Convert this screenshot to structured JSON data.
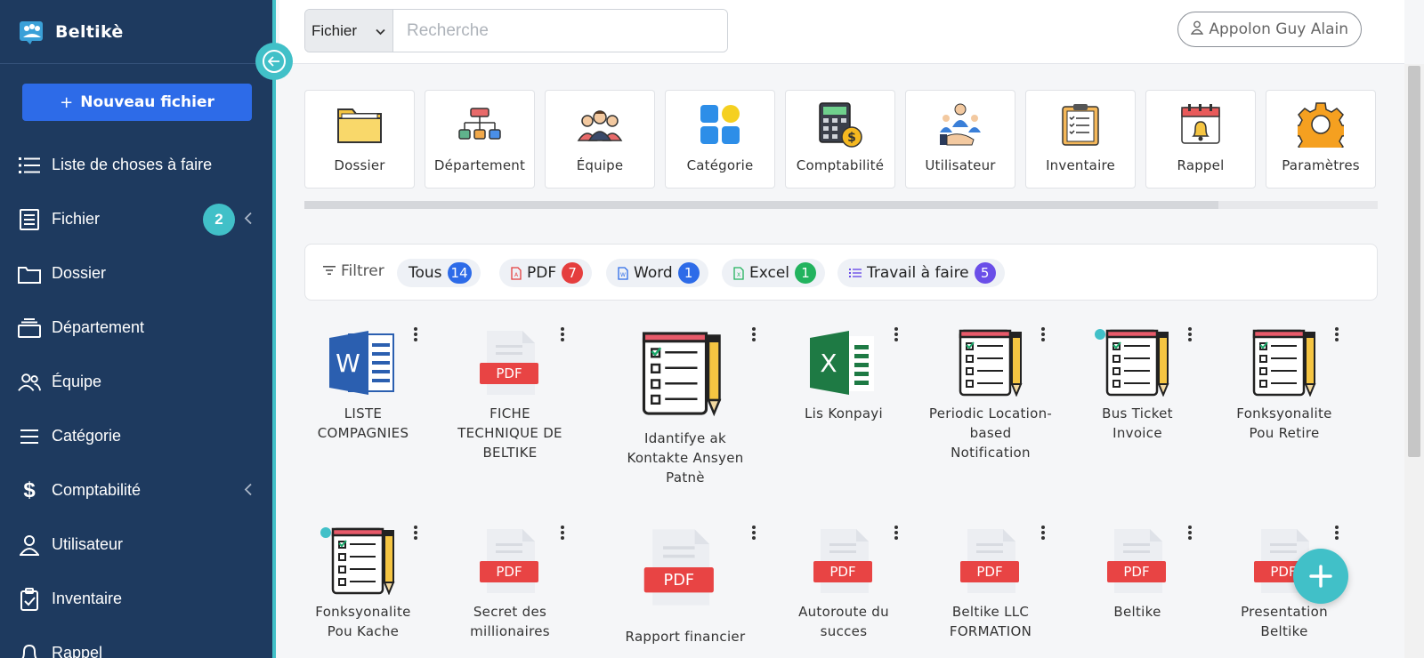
{
  "brand": {
    "name": "Beltikè"
  },
  "sidebar": {
    "new_button": "Nouveau fichier",
    "items": [
      {
        "label": "Liste de choses à faire",
        "icon": "list-icon"
      },
      {
        "label": "Fichier",
        "icon": "file-icon",
        "badge": "2"
      },
      {
        "label": "Dossier",
        "icon": "folder-icon"
      },
      {
        "label": "Département",
        "icon": "department-icon"
      },
      {
        "label": "Équipe",
        "icon": "team-icon"
      },
      {
        "label": "Catégorie",
        "icon": "category-icon"
      },
      {
        "label": "Comptabilité",
        "icon": "dollar-icon"
      },
      {
        "label": "Utilisateur",
        "icon": "user-icon"
      },
      {
        "label": "Inventaire",
        "icon": "clipboard-icon"
      },
      {
        "label": "Rappel",
        "icon": "bell-icon"
      }
    ]
  },
  "search": {
    "scope": "Fichier",
    "placeholder": "Recherche"
  },
  "user": {
    "name": "Appolon Guy Alain"
  },
  "categories": [
    {
      "label": "Dossier"
    },
    {
      "label": "Département"
    },
    {
      "label": "Équipe"
    },
    {
      "label": "Catégorie"
    },
    {
      "label": "Comptabilité"
    },
    {
      "label": "Utilisateur"
    },
    {
      "label": "Inventaire"
    },
    {
      "label": "Rappel"
    },
    {
      "label": "Paramètres"
    }
  ],
  "filters": {
    "label": "Filtrer",
    "chips": [
      {
        "label": "Tous",
        "count": "14",
        "color": "#2d6be8"
      },
      {
        "label": "PDF",
        "count": "7",
        "color": "#e53e3e"
      },
      {
        "label": "Word",
        "count": "1",
        "color": "#2d6be8"
      },
      {
        "label": "Excel",
        "count": "1",
        "color": "#22b35e"
      },
      {
        "label": "Travail à faire",
        "count": "5",
        "color": "#6a4ee8"
      }
    ]
  },
  "files": [
    {
      "name": "LISTE COMPAGNIES",
      "type": "word"
    },
    {
      "name": "FICHE TECHNIQUE DE BELTIKE",
      "type": "pdf"
    },
    {
      "name": "Idantifye ak Kontakte Ansyen Patnè",
      "type": "todo"
    },
    {
      "name": "Lis Konpayi",
      "type": "excel"
    },
    {
      "name": "Periodic Location-based Notification",
      "type": "todo"
    },
    {
      "name": "Bus Ticket Invoice",
      "type": "todo"
    },
    {
      "name": "Fonksyonalite Pou Retire",
      "type": "todo"
    },
    {
      "name": "Fonksyonalite Pou Kache",
      "type": "todo"
    },
    {
      "name": "Secret des millionaires",
      "type": "pdf"
    },
    {
      "name": "Rapport financier",
      "type": "pdf"
    },
    {
      "name": "Autoroute du succes",
      "type": "pdf"
    },
    {
      "name": "Beltike LLC FORMATION",
      "type": "pdf"
    },
    {
      "name": "Beltike",
      "type": "pdf"
    },
    {
      "name": "Presentation Beltike",
      "type": "pdf"
    }
  ],
  "pdf_label": "PDF",
  "word_label": "W",
  "excel_label": "X"
}
